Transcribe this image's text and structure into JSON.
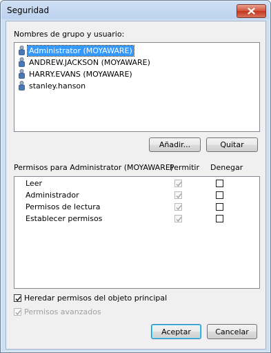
{
  "window": {
    "title": "Seguridad",
    "close_icon": "close-icon"
  },
  "users": {
    "label": "Nombres de grupo y usuario:",
    "items": [
      {
        "name": "Administrator (MOYAWARE)",
        "selected": true
      },
      {
        "name": "ANDREW.JACKSON (MOYAWARE)",
        "selected": false
      },
      {
        "name": "HARRY.EVANS (MOYAWARE)",
        "selected": false
      },
      {
        "name": "stanley.hanson",
        "selected": false
      }
    ],
    "add_label": "Añadir...",
    "remove_label": "Quitar"
  },
  "permissions": {
    "title": "Permisos para Administrator (MOYAWARE)",
    "col_allow": "Permitir",
    "col_deny": "Denegar",
    "rows": [
      {
        "name": "Leer",
        "allow": true,
        "deny": false
      },
      {
        "name": "Administrador",
        "allow": true,
        "deny": false
      },
      {
        "name": "Permisos de lectura",
        "allow": true,
        "deny": false
      },
      {
        "name": "Establecer permisos",
        "allow": true,
        "deny": false
      }
    ]
  },
  "options": {
    "inherit_label": "Heredar permisos del objeto principal",
    "inherit_checked": true,
    "advanced_label": "Permisos avanzados",
    "advanced_checked": true
  },
  "footer": {
    "ok_label": "Aceptar",
    "cancel_label": "Cancelar"
  },
  "colors": {
    "selection": "#3399ff",
    "titlebar": "#bcd2ee",
    "close": "#c3361f"
  }
}
